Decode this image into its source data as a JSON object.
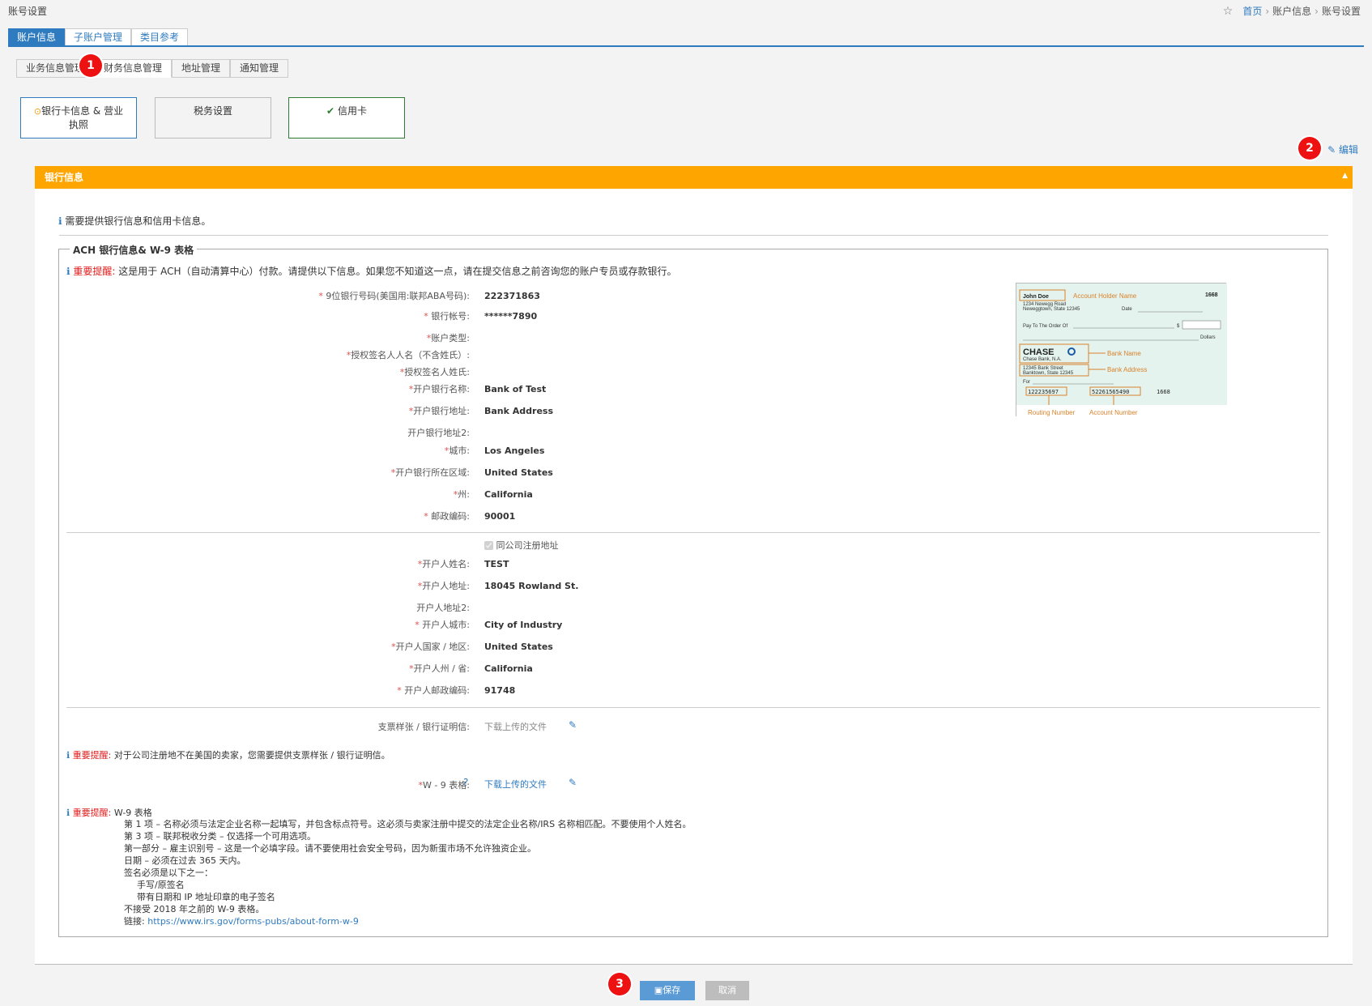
{
  "header": {
    "page_title": "账号设置",
    "breadcrumbs": [
      "首页",
      "账户信息",
      "账号设置"
    ]
  },
  "tabs": [
    "账户信息",
    "子账户管理",
    "类目参考"
  ],
  "subtabs": [
    "业务信息管理",
    "财务信息管理",
    "地址管理",
    "通知管理"
  ],
  "cards": [
    "银行卡信息 & 营业执照",
    "税务设置",
    "信用卡"
  ],
  "edit_label": "编辑",
  "markers": [
    "1",
    "2",
    "3"
  ],
  "panel": {
    "title": "银行信息"
  },
  "notice": "需要提供银行信息和信用卡信息。",
  "section": {
    "legend": "ACH 银行信息& W-9 表格"
  },
  "remind_label": "重要提醒:",
  "remind1": "这是用于 ACH（自动清算中心）付款。请提供以下信息。如果您不知道这一点，请在提交信息之前咨询您的账户专员或存款银行。",
  "bank_fields": [
    {
      "label": "9位银行号码(美国用:联邦ABA号码):",
      "value": "222371863"
    },
    {
      "label": "银行帐号:",
      "value": "******7890"
    },
    {
      "label": "账户类型:",
      "value": ""
    },
    {
      "label": "授权签名人人名（不含姓氏）:",
      "value": ""
    },
    {
      "label": "授权签名人姓氏:",
      "value": ""
    },
    {
      "label": "开户银行名称:",
      "value": "Bank of Test"
    },
    {
      "label": "开户银行地址:",
      "value": "Bank Address"
    },
    {
      "label": "开户银行地址2:",
      "value": ""
    },
    {
      "label": "城市:",
      "value": "Los Angeles"
    },
    {
      "label": "开户银行所在区域:",
      "value": "United States"
    },
    {
      "label": "州:",
      "value": "California"
    },
    {
      "label": "邮政编码:",
      "value": "90001"
    }
  ],
  "same_address_label": "同公司注册地址",
  "holder_fields": [
    {
      "label": "开户人姓名:",
      "value": "TEST"
    },
    {
      "label": "开户人地址:",
      "value": "18045 Rowland St."
    },
    {
      "label": "开户人地址2:",
      "value": ""
    },
    {
      "label": "开户人城市:",
      "value": "City of Industry"
    },
    {
      "label": "开户人国家 / 地区:",
      "value": "United States"
    },
    {
      "label": "开户人州 / 省:",
      "value": "California"
    },
    {
      "label": "开户人邮政编码:",
      "value": "91748"
    }
  ],
  "check_sample": {
    "name": "John Doe",
    "number": "1668",
    "addr1": "1234 Newegg Road",
    "addr2": "Neweggtown, State 12345",
    "date": "Date",
    "pay": "Pay To The Order Of",
    "dollar": "$",
    "dollars": "Dollars",
    "bank": "CHASE",
    "bank_sub": "Chase Bank, N.A.",
    "bank_addr1": "12345 Bank Street",
    "bank_addr2": "Banktown, State 12345",
    "for": "For",
    "micr_routing": "122235697",
    "micr_account": "52261565490",
    "micr_check": "1668",
    "lbl_holder": "Account Holder Name",
    "lbl_bank": "Bank Name",
    "lbl_bank_addr": "Bank Address",
    "lbl_routing": "Routing Number",
    "lbl_account": "Account Number"
  },
  "cheque_label": "支票样张 / 银行证明信:",
  "cheque_file": "下载上传的文件",
  "remind2": "对于公司注册地不在美国的卖家，您需要提供支票样张 / 银行证明信。",
  "w9_label": "W - 9 表格:",
  "w9_file": "下载上传的文件",
  "w9_title": "W-9 表格",
  "w9_lines": [
    "第 1 项 – 名称必须与法定企业名称一起填写，并包含标点符号。这必须与卖家注册中提交的法定企业名称/IRS 名称相匹配。不要使用个人姓名。",
    "第 3 项 – 联邦税收分类 – 仅选择一个可用选项。",
    "第一部分 – 雇主识别号 – 这是一个必填字段。请不要使用社会安全号码，因为新蛋市场不允许独资企业。",
    "日期 – 必须在过去 365 天内。",
    "签名必须是以下之一：",
    "手写/原签名",
    "带有日期和 IP 地址印章的电子签名",
    "不接受 2018 年之前的 W-9 表格。"
  ],
  "w9_link_label": "链接:",
  "w9_link": "https://www.irs.gov/forms-pubs/about-form-w-9",
  "buttons": {
    "save": "保存",
    "cancel": "取消"
  }
}
